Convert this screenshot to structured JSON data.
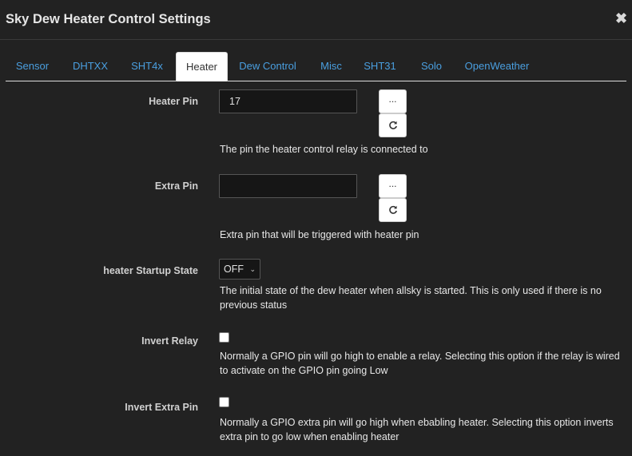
{
  "dialog": {
    "title": "Sky Dew Heater Control Settings",
    "close_glyph": "✖"
  },
  "tabs": [
    {
      "label": "Sensor",
      "active": false
    },
    {
      "label": "DHTXX",
      "active": false
    },
    {
      "label": "SHT4x",
      "active": false
    },
    {
      "label": "Heater",
      "active": true
    },
    {
      "label": "Dew Control",
      "active": false
    },
    {
      "label": "Misc",
      "active": false
    },
    {
      "label": "SHT31",
      "active": false
    },
    {
      "label": "Solo",
      "active": false
    },
    {
      "label": "OpenWeather",
      "active": false
    }
  ],
  "heater_pin": {
    "label": "Heater Pin",
    "value": "17",
    "browse_label": "...",
    "reset_icon": "refresh-icon",
    "help": "The pin the heater control relay is connected to"
  },
  "extra_pin": {
    "label": "Extra Pin",
    "value": "",
    "browse_label": "...",
    "reset_icon": "refresh-icon",
    "help": "Extra pin that will be triggered with heater pin"
  },
  "startup_state": {
    "label": "heater Startup State",
    "selected": "OFF",
    "help_line1": "The initial state of the dew heater when allsky is started. This is only used if there is no",
    "help_line2": "previous status"
  },
  "invert_relay": {
    "label": "Invert Relay",
    "checked": false,
    "help_line1": "Normally a GPIO pin will go high to enable a relay. Selecting this option if the relay is wired",
    "help_line2": "to activate on the GPIO pin going Low"
  },
  "invert_extra_pin": {
    "label": "Invert Extra Pin",
    "checked": false,
    "help_line1": "Normally a GPIO extra pin will go high when ebabling heater. Selecting this option inverts",
    "help_line2": "extra pin to go low when enabling heater"
  },
  "colors": {
    "background": "#222222",
    "tab_link": "#4a9fe0",
    "label": "#d0d0d0"
  }
}
